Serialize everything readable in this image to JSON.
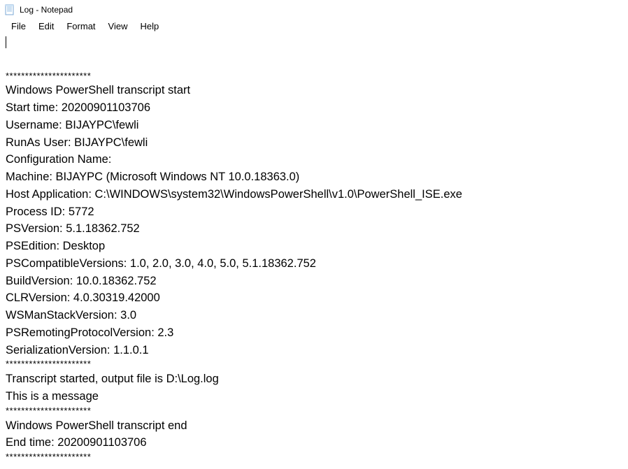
{
  "window": {
    "title": "Log - Notepad"
  },
  "menubar": {
    "file": "File",
    "edit": "Edit",
    "format": "Format",
    "view": "View",
    "help": "Help"
  },
  "content": {
    "lines": [
      {
        "type": "sep",
        "text": "**********************"
      },
      {
        "type": "main",
        "text": "Windows PowerShell transcript start"
      },
      {
        "type": "main",
        "text": "Start time: 20200901103706"
      },
      {
        "type": "main",
        "text": "Username: BIJAYPC\\fewli"
      },
      {
        "type": "main",
        "text": "RunAs User: BIJAYPC\\fewli"
      },
      {
        "type": "main",
        "text": "Configuration Name:"
      },
      {
        "type": "main",
        "text": "Machine: BIJAYPC (Microsoft Windows NT 10.0.18363.0)"
      },
      {
        "type": "main",
        "text": "Host Application: C:\\WINDOWS\\system32\\WindowsPowerShell\\v1.0\\PowerShell_ISE.exe"
      },
      {
        "type": "main",
        "text": "Process ID: 5772"
      },
      {
        "type": "main",
        "text": "PSVersion: 5.1.18362.752"
      },
      {
        "type": "main",
        "text": "PSEdition: Desktop"
      },
      {
        "type": "main",
        "text": "PSCompatibleVersions: 1.0, 2.0, 3.0, 4.0, 5.0, 5.1.18362.752"
      },
      {
        "type": "main",
        "text": "BuildVersion: 10.0.18362.752"
      },
      {
        "type": "main",
        "text": "CLRVersion: 4.0.30319.42000"
      },
      {
        "type": "main",
        "text": "WSManStackVersion: 3.0"
      },
      {
        "type": "main",
        "text": "PSRemotingProtocolVersion: 2.3"
      },
      {
        "type": "main",
        "text": "SerializationVersion: 1.1.0.1"
      },
      {
        "type": "sep",
        "text": "**********************"
      },
      {
        "type": "main",
        "text": "Transcript started, output file is D:\\Log.log"
      },
      {
        "type": "main",
        "text": "This is a message"
      },
      {
        "type": "sep",
        "text": "**********************"
      },
      {
        "type": "main",
        "text": "Windows PowerShell transcript end"
      },
      {
        "type": "main",
        "text": "End time: 20200901103706"
      },
      {
        "type": "sep",
        "text": "**********************"
      }
    ]
  }
}
